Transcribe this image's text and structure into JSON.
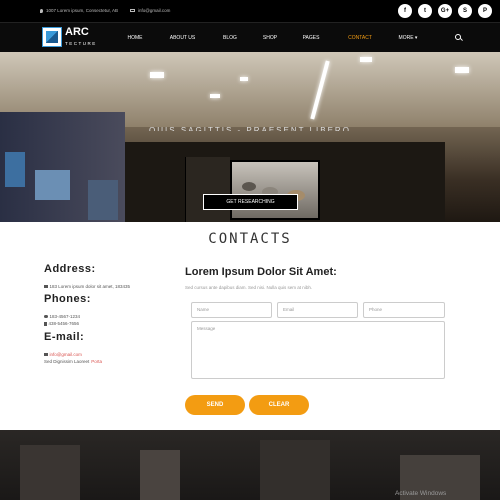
{
  "topbar": {
    "address": "1007 Lorem ipsum, Consectetur, AB",
    "email": "info@gmail.com",
    "socials": [
      {
        "icon": "facebook-icon",
        "glyph": "f"
      },
      {
        "icon": "twitter-icon",
        "glyph": "t"
      },
      {
        "icon": "google-plus-icon",
        "glyph": "G+"
      },
      {
        "icon": "skype-icon",
        "glyph": "S"
      },
      {
        "icon": "pinterest-icon",
        "glyph": "P"
      }
    ]
  },
  "logo": {
    "line1": "ARC",
    "line2": "TECTURE"
  },
  "nav": {
    "items": [
      "HOME",
      "ABOUT US",
      "BLOG",
      "SHOP",
      "PAGES",
      "CONTACT",
      "MORE ▾"
    ],
    "active": "CONTACT"
  },
  "hero": {
    "overlay_text": "QUIS SAGITTIS - PRAESENT LIBERO",
    "button": "GET RESEARCHING"
  },
  "contacts": {
    "title": "CONTACTS",
    "address_heading": "Address:",
    "address": "183 Lorem ipsum dolor sit amet, 183435",
    "phones_heading": "Phones:",
    "phone1": "183-4567-1234",
    "phone2": "438-5456-7656",
    "email_heading": "E-mail:",
    "email": "info@gmail.com",
    "extra_text": "Sed Dignissim Laoreet",
    "extra_link": "Porta"
  },
  "form": {
    "title": "Lorem Ipsum Dolor Sit Amet:",
    "subtitle": "Sed cursus ante dapibus diam. Sed nisi. Nulla quis sem at nibh.",
    "name_placeholder": "Name",
    "email_placeholder": "Email",
    "phone_placeholder": "Phone",
    "message_placeholder": "Message",
    "send": "SEND",
    "clear": "CLEAR"
  },
  "overlay": {
    "activate": "Activate Windows"
  },
  "colors": {
    "accent": "#f39c12",
    "nav_bg": "#0b0b0b",
    "link": "#d9534f"
  }
}
